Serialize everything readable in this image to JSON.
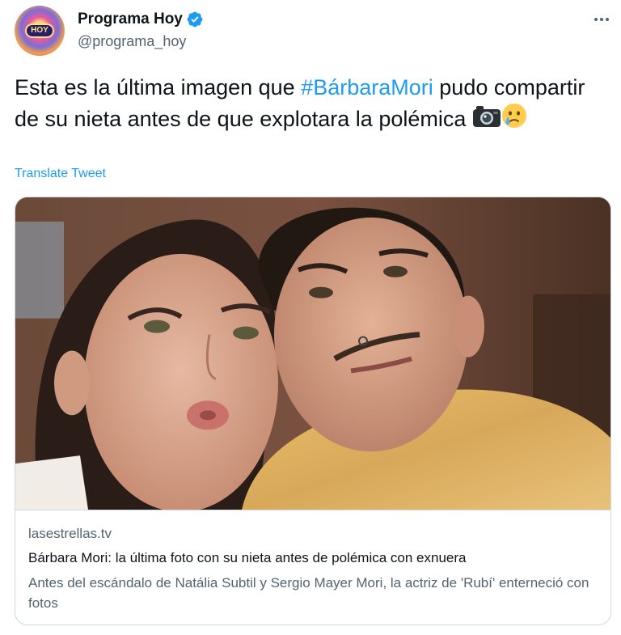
{
  "author": {
    "display_name": "Programa Hoy",
    "handle": "@programa_hoy",
    "verified_icon": "verified-badge-icon",
    "avatar_logo_text": "HOY"
  },
  "tweet": {
    "text_before": "Esta es la última imagen que ",
    "hashtag": "#BárbaraMori",
    "text_after": " pudo compartir de su nieta antes de que explotara la polémica ",
    "emojis": [
      "camera-emoji",
      "crying-face-emoji"
    ],
    "translate_label": "Translate Tweet"
  },
  "card": {
    "domain": "lasestrellas.tv",
    "title": "Bárbara Mori: la última foto con su nieta antes de polémica con exnuera",
    "description": "Antes del escándalo de Natália Subtil y Sergio Mayer Mori, la actriz de 'Rubí' enterneció con fotos"
  },
  "colors": {
    "accent": "#1d9bf0",
    "text_primary": "#0f1419",
    "text_secondary": "#536471",
    "border": "#cfd9de"
  }
}
